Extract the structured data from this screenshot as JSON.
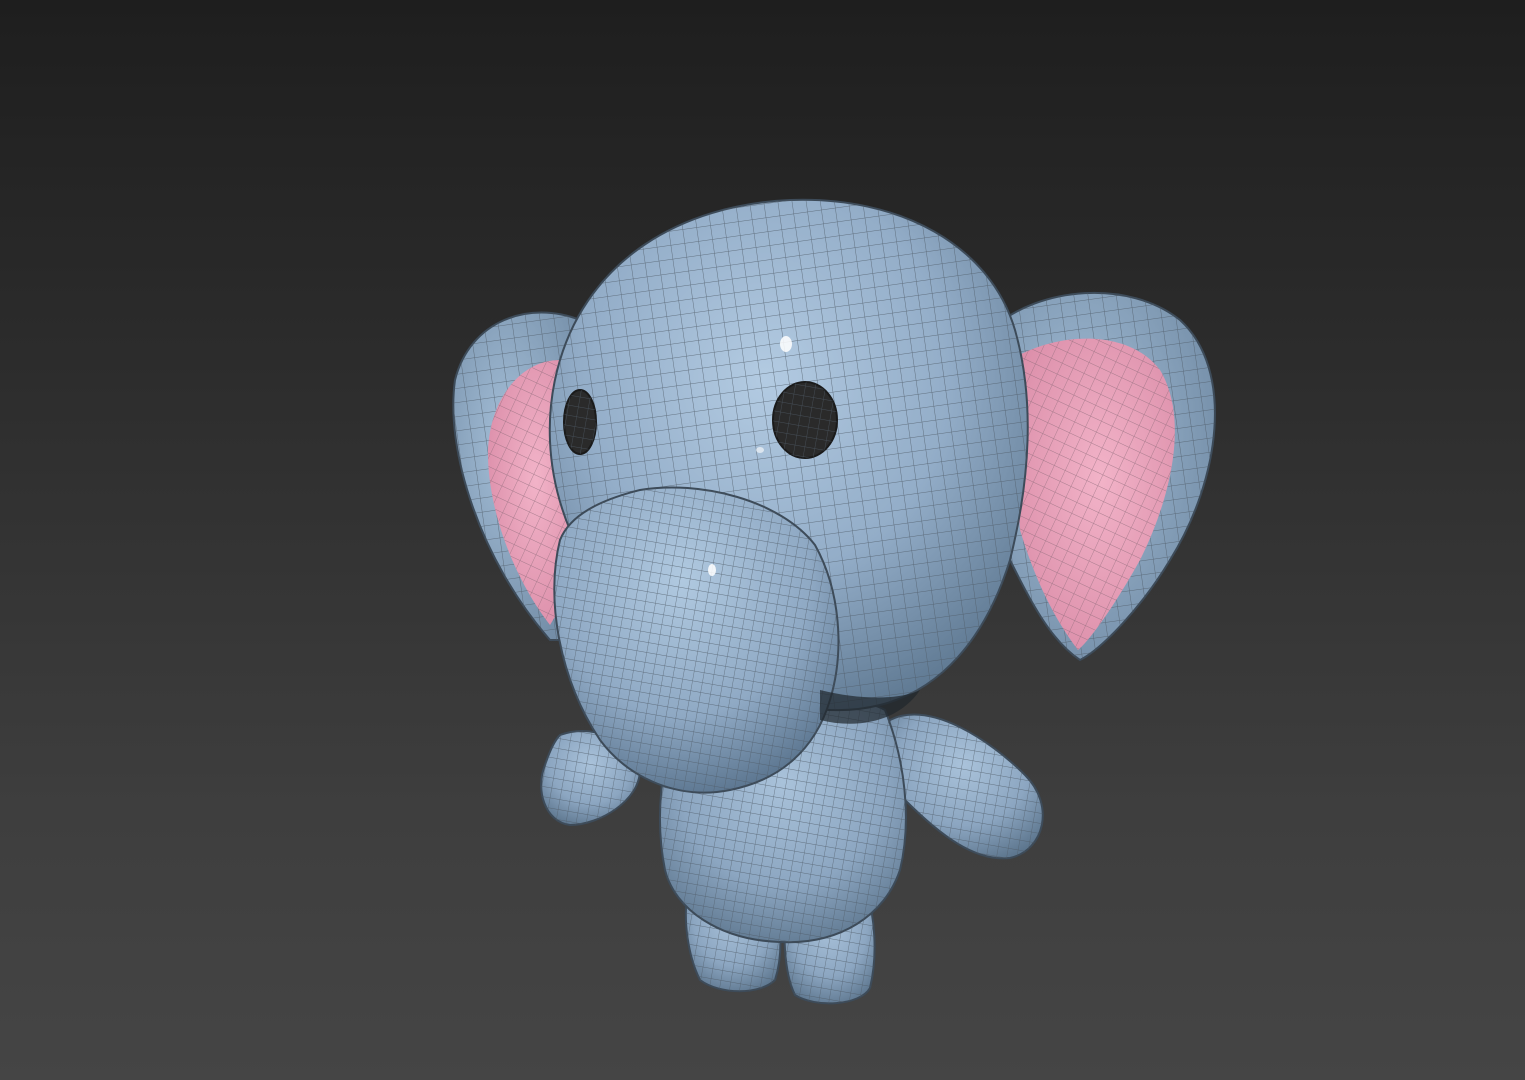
{
  "viewport": {
    "background_top": "#1e1e1e",
    "background_bottom": "#454545"
  },
  "model": {
    "subject": "cartoon-elephant",
    "body_color": "#8fa9c4",
    "ear_inner_color": "#e79db6",
    "eye_color": "#2a2a2a",
    "wire_color": "#5a5a5a",
    "display_mode": "shaded-with-wireframe"
  }
}
